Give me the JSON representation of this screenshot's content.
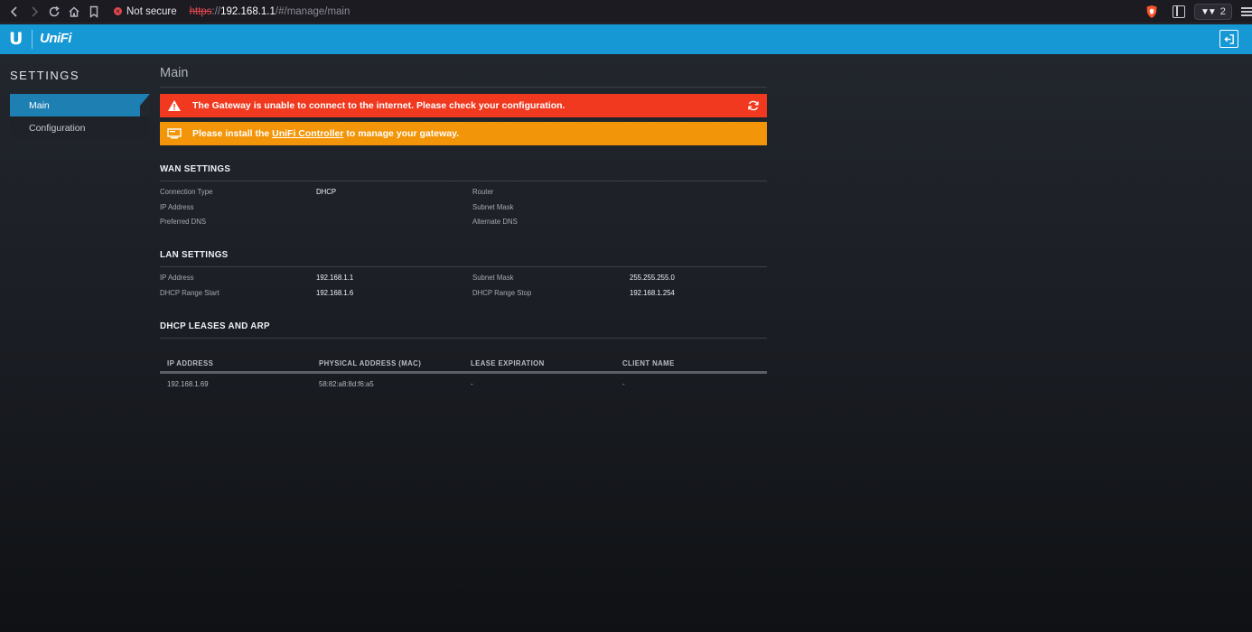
{
  "browser": {
    "security_label": "Not secure",
    "url_proto": "https",
    "url_sep": "://",
    "url_host": "192.168.1.1",
    "url_path": "/#/manage/main",
    "extension_count": "2"
  },
  "header": {
    "brand": "UniFi",
    "accent_color": "#1598d4"
  },
  "sidebar": {
    "title": "SETTINGS",
    "items": [
      {
        "label": "Main",
        "active": true
      },
      {
        "label": "Configuration",
        "active": false
      }
    ]
  },
  "main": {
    "title": "Main",
    "alerts": {
      "error": "The Gateway is unable to connect to the internet. Please check your configuration.",
      "warning_prefix": "Please install the ",
      "warning_link": "UniFi Controller",
      "warning_suffix": " to manage your gateway."
    },
    "wan": {
      "title": "WAN SETTINGS",
      "connection_type_label": "Connection Type",
      "connection_type_value": "DHCP",
      "ip_label": "IP Address",
      "ip_value": "",
      "preferred_dns_label": "Preferred DNS",
      "preferred_dns_value": "",
      "router_label": "Router",
      "router_value": "",
      "subnet_label": "Subnet Mask",
      "subnet_value": "",
      "alt_dns_label": "Alternate DNS",
      "alt_dns_value": ""
    },
    "lan": {
      "title": "LAN SETTINGS",
      "ip_label": "IP Address",
      "ip_value": "192.168.1.1",
      "range_start_label": "DHCP Range Start",
      "range_start_value": "192.168.1.6",
      "subnet_label": "Subnet Mask",
      "subnet_value": "255.255.255.0",
      "range_stop_label": "DHCP Range Stop",
      "range_stop_value": "192.168.1.254"
    },
    "dhcp": {
      "title": "DHCP LEASES AND ARP",
      "columns": [
        "IP ADDRESS",
        "PHYSICAL ADDRESS (MAC)",
        "LEASE EXPIRATION",
        "CLIENT NAME"
      ],
      "rows": [
        [
          "192.168.1.69",
          "58:82:a8:8d:f6:a5",
          "-",
          "-"
        ]
      ]
    }
  },
  "colors": {
    "error": "#f0391f",
    "warning": "#f39508",
    "active_nav": "#1e7fb3"
  }
}
